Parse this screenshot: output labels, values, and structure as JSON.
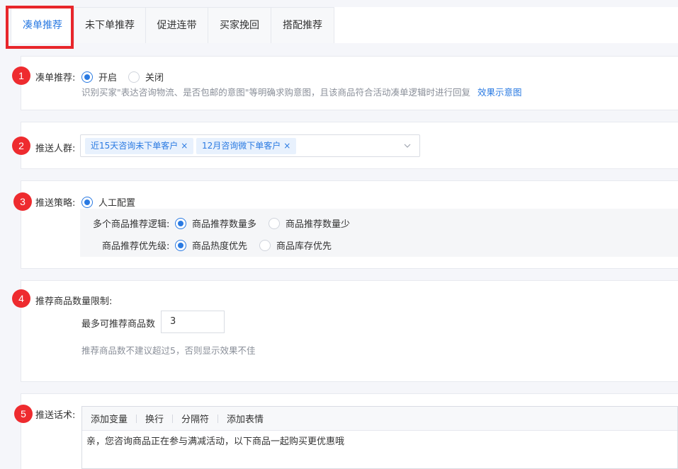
{
  "tabs": [
    {
      "label": "凑单推荐",
      "active": true
    },
    {
      "label": "未下单推荐",
      "active": false
    },
    {
      "label": "促进连带",
      "active": false
    },
    {
      "label": "买家挽回",
      "active": false
    },
    {
      "label": "搭配推荐",
      "active": false
    }
  ],
  "section1": {
    "badge": "1",
    "label": "凑单推荐:",
    "option_on": "开启",
    "option_off": "关闭",
    "selected": "开启",
    "desc": "识别买家\"表达咨询物流、是否包邮的意图\"等明确求购意图，且该商品符合活动凑单逻辑时进行回复",
    "link": "效果示意图"
  },
  "section2": {
    "badge": "2",
    "label": "推送人群:",
    "tags": [
      "近15天咨询未下单客户",
      "12月咨询微下单客户"
    ],
    "remove_icon": "×"
  },
  "section3": {
    "badge": "3",
    "label": "推送策略:",
    "mode": "人工配置",
    "logic_label": "多个商品推荐逻辑:",
    "logic_options": [
      "商品推荐数量多",
      "商品推荐数量少"
    ],
    "logic_selected": "商品推荐数量多",
    "priority_label": "商品推荐优先级:",
    "priority_options": [
      "商品热度优先",
      "商品库存优先"
    ],
    "priority_selected": "商品热度优先"
  },
  "section4": {
    "badge": "4",
    "title": "推荐商品数量限制:",
    "max_label": "最多可推荐商品数",
    "max_value": "3",
    "hint": "推荐商品数不建议超过5，否则显示效果不佳"
  },
  "section5": {
    "badge": "5",
    "label": "推送话术:",
    "toolbar": [
      "添加变量",
      "换行",
      "分隔符",
      "添加表情"
    ],
    "content": "亲，您咨询商品正在参与满减活动，以下商品一起购买更优惠哦"
  },
  "colors": {
    "accent": "#2a7ae2",
    "badge": "#ee2b2f",
    "highlight": "#e8262b"
  }
}
